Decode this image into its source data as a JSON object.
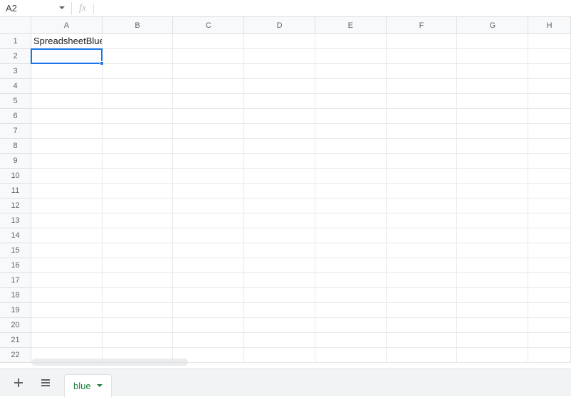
{
  "name_box": {
    "value": "A2"
  },
  "formula_bar": {
    "fx_label": "fx",
    "value": ""
  },
  "columns": [
    "A",
    "B",
    "C",
    "D",
    "E",
    "F",
    "G",
    "H"
  ],
  "rows": [
    "1",
    "2",
    "3",
    "4",
    "5",
    "6",
    "7",
    "8",
    "9",
    "10",
    "11",
    "12",
    "13",
    "14",
    "15",
    "16",
    "17",
    "18",
    "19",
    "20",
    "21",
    "22"
  ],
  "cells": {
    "A1": "SpreadsheetBlue"
  },
  "selection": {
    "ref": "A2",
    "col_index": 0,
    "row_index": 1
  },
  "sheet_tab": {
    "name": "blue"
  },
  "colors": {
    "selection": "#1a73e8",
    "tab_text": "#188038"
  }
}
